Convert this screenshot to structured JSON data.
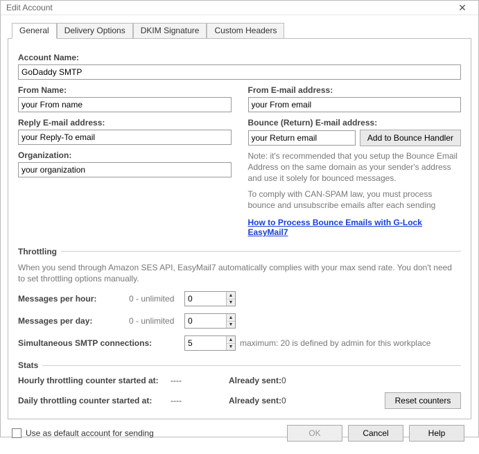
{
  "window": {
    "title": "Edit Account"
  },
  "tabs": [
    {
      "label": "General",
      "active": true
    },
    {
      "label": "Delivery Options",
      "active": false
    },
    {
      "label": "DKIM Signature",
      "active": false
    },
    {
      "label": "Custom Headers",
      "active": false
    }
  ],
  "account": {
    "name_label": "Account Name:",
    "name": "GoDaddy SMTP",
    "from_name_label": "From Name:",
    "from_name": "your From name",
    "reply_label": "Reply E-mail address:",
    "reply": "your Reply-To email",
    "org_label": "Organization:",
    "org": "your organization",
    "from_email_label": "From E-mail address:",
    "from_email": "your From email",
    "bounce_label": "Bounce (Return) E-mail address:",
    "bounce": "your Return email",
    "add_to_bounce_btn": "Add to Bounce Handler",
    "bounce_note1": "Note: it's recommended that you setup the Bounce Email Address on the same domain as your sender's address and use it solely for bounced messages.",
    "bounce_note2": "To comply with CAN-SPAM law, you must process bounce and unsubscribe emails after each sending",
    "bounce_link": "How to Process Bounce Emails with G-Lock EasyMail7"
  },
  "throttling": {
    "legend": "Throttling",
    "desc": "When you send through Amazon SES API, EasyMail7 automatically complies with your max send rate. You don't need to set throttling options manually.",
    "msg_hour_label": "Messages per hour:",
    "msg_hour_hint": "0 - unlimited",
    "msg_hour_value": "0",
    "msg_day_label": "Messages per day:",
    "msg_day_hint": "0 - unlimited",
    "msg_day_value": "0",
    "smtp_conn_label": "Simultaneous SMTP connections:",
    "smtp_conn_value": "5",
    "smtp_conn_hint": "maximum: 20 is defined by admin for this workplace"
  },
  "stats": {
    "legend": "Stats",
    "hourly_label": "Hourly throttling counter started at:",
    "hourly_value": "----",
    "daily_label": "Daily throttling counter started at:",
    "daily_value": "----",
    "already_sent_label": "Already sent:",
    "hourly_sent": "0",
    "daily_sent": "0",
    "reset_btn": "Reset counters"
  },
  "footer": {
    "default_checkbox_label": "Use as default account for sending",
    "ok": "OK",
    "cancel": "Cancel",
    "help": "Help"
  }
}
